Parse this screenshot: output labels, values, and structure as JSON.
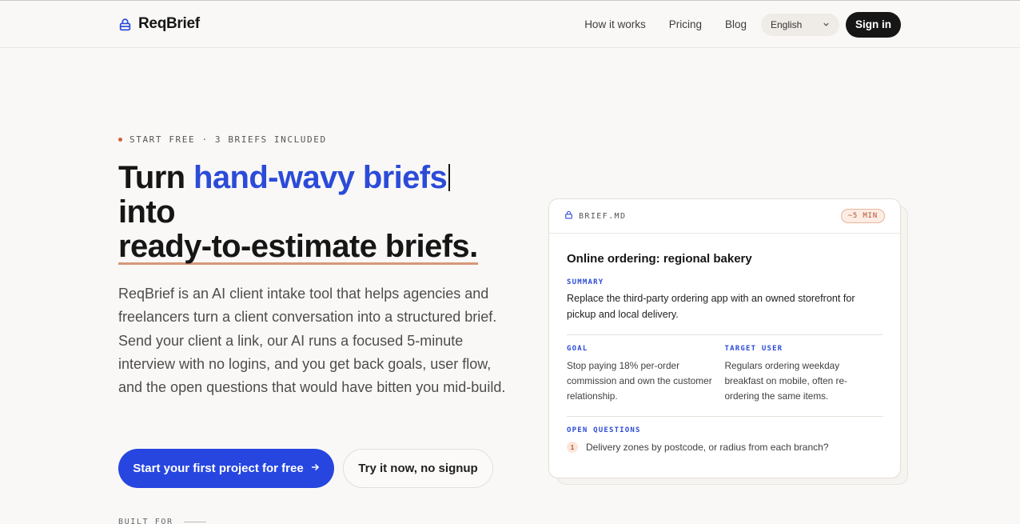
{
  "brand": {
    "name": "ReqBrief"
  },
  "nav": {
    "links": [
      "How it works",
      "Pricing",
      "Blog"
    ],
    "language": "English",
    "signin": "Sign in"
  },
  "hero": {
    "eyebrow": "START FREE · 3 BRIEFS INCLUDED",
    "headline_part1": "Turn ",
    "headline_accent": "hand-wavy briefs",
    "headline_part2": "into",
    "headline_part3": "ready-to-estimate briefs.",
    "lead": "ReqBrief is an AI client intake tool that helps agencies and freelancers turn a client conversation into a structured brief. Send your client a link, our AI runs a focused 5-minute interview with no logins, and you get back goals, user flow, and the open questions that would have bitten you mid-build.",
    "cta_primary": "Start your first project for free",
    "cta_secondary": "Try it now, no signup",
    "built_for": "BUILT FOR"
  },
  "card": {
    "filename": "BRIEF.MD",
    "badge": "~5 MIN",
    "title": "Online ordering: regional bakery",
    "summary_label": "SUMMARY",
    "summary": "Replace the third-party ordering app with an owned storefront for pickup and local delivery.",
    "goal_label": "GOAL",
    "goal": "Stop paying 18% per-order commission and own the customer relationship.",
    "target_label": "TARGET USER",
    "target": "Regulars ordering weekday breakfast on mobile, often re-ordering the same items.",
    "questions_label": "OPEN QUESTIONS",
    "questions": [
      {
        "num": "1",
        "text": "Delivery zones by postcode, or radius from each branch?"
      }
    ]
  },
  "colors": {
    "accent": "#2b4bd8",
    "primary_button": "#2746e0",
    "eyebrow_dot": "#d0623a",
    "underline": "#d69878",
    "badge": "#b2532c"
  },
  "icons": [
    "lock-icon",
    "chevron-down-icon",
    "arrow-right-icon",
    "file-lock-icon"
  ]
}
